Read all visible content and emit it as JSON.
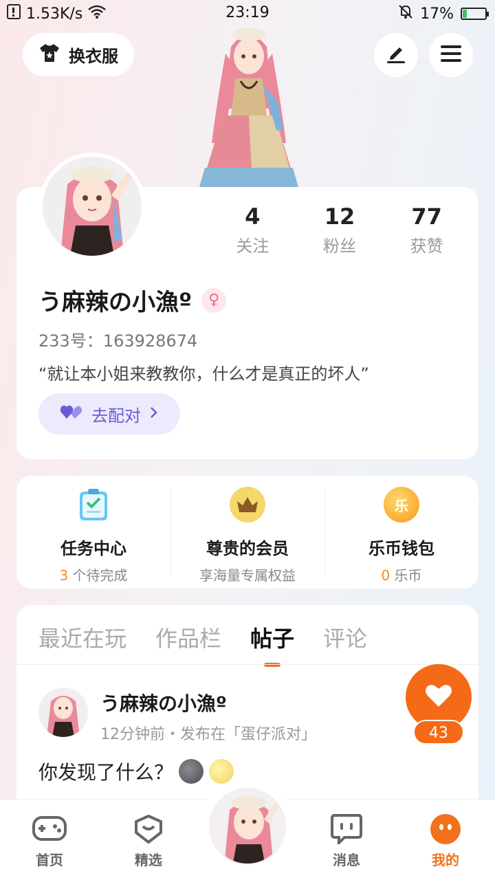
{
  "status_bar": {
    "speed": "1.53K/s",
    "time": "23:19",
    "battery": "17%",
    "battery_level": 0.17
  },
  "top": {
    "outfit_label": "换衣服"
  },
  "profile": {
    "stats": [
      {
        "num": "4",
        "label": "关注"
      },
      {
        "num": "12",
        "label": "粉丝"
      },
      {
        "num": "77",
        "label": "获赞"
      }
    ],
    "name": "う麻辣の小漁º",
    "gender_symbol": "♀",
    "uid": "233号：163928674",
    "bio": "“就让本小姐来教教你，什么才是真正的坏人”",
    "match_label": "去配对"
  },
  "services": [
    {
      "title": "任务中心",
      "count": "3",
      "sub": "个待完成"
    },
    {
      "title": "尊贵的会员",
      "sub": "享海量专属权益"
    },
    {
      "title": "乐币钱包",
      "count": "0",
      "sub": "乐币",
      "icon_char": "乐"
    }
  ],
  "tabs": [
    "最近在玩",
    "作品栏",
    "帖子",
    "评论"
  ],
  "active_tab": "帖子",
  "post": {
    "author": "う麻辣の小漁º",
    "meta": "12分钟前・发布在「蛋仔派对」",
    "text": "你发现了什么？"
  },
  "like": {
    "count": "43"
  },
  "nav": [
    {
      "label": "首页",
      "icon": "gamepad-icon"
    },
    {
      "label": "精选",
      "icon": "heart-box-icon"
    },
    {
      "label": "消息",
      "icon": "chat-icon"
    },
    {
      "label": "我的",
      "icon": "face-icon"
    }
  ],
  "colors": {
    "accent": "#f2711c",
    "match_bg": "#ecebfd",
    "match_text": "#6a5ad6"
  }
}
